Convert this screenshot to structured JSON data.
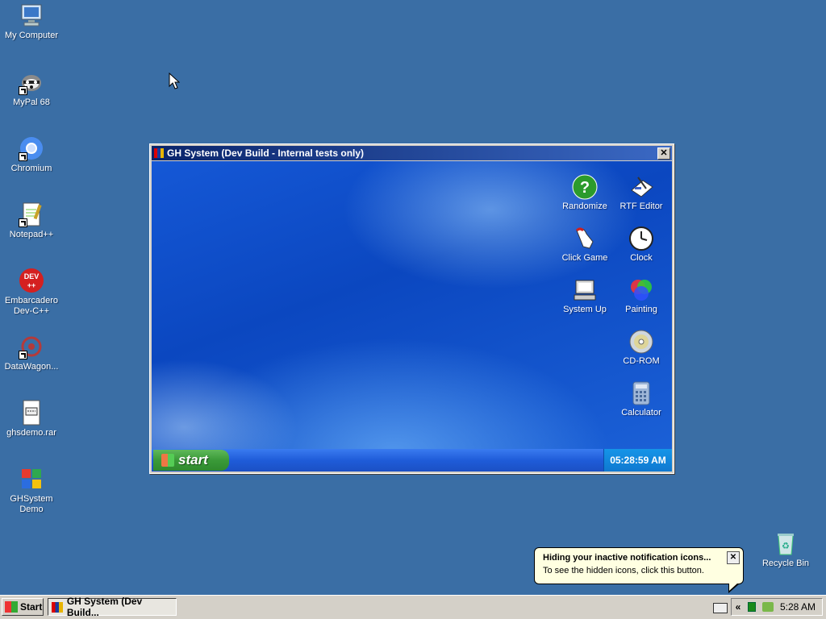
{
  "desktop": {
    "icons": [
      {
        "label": "My Computer"
      },
      {
        "label": "MyPal 68"
      },
      {
        "label": "Chromium"
      },
      {
        "label": "Notepad++"
      },
      {
        "label": "Embarcadero\nDev-C++"
      },
      {
        "label": "DataWagon..."
      },
      {
        "label": "ghsdemo.rar"
      },
      {
        "label": "GHSystem\nDemo"
      },
      {
        "label": "Recycle Bin"
      }
    ]
  },
  "window": {
    "title": "GH System (Dev Build - Internal tests only)",
    "close_glyph": "✕",
    "icons": [
      {
        "label": "Randomize",
        "icon": "help-icon"
      },
      {
        "label": "RTF Editor",
        "icon": "rtf-editor-icon"
      },
      {
        "label": "Click Game",
        "icon": "pointer-hand-icon"
      },
      {
        "label": "Clock",
        "icon": "clock-icon"
      },
      {
        "label": "System Up",
        "icon": "computer-icon"
      },
      {
        "label": "Painting",
        "icon": "paint-colors-icon"
      },
      {
        "label": "CD-ROM",
        "icon": "cd-icon"
      },
      {
        "label": "Calculator",
        "icon": "calculator-icon"
      }
    ],
    "taskbar": {
      "start_label": "start",
      "clock": "05:28:59 AM"
    }
  },
  "balloon": {
    "title": "Hiding your inactive notification icons...",
    "body": "To see the hidden icons, click this button.",
    "close_glyph": "✕"
  },
  "taskbar": {
    "start_label": "Start",
    "task_label": "GH System (Dev Build...",
    "tray_chevron": "«",
    "clock": "5:28 AM"
  }
}
